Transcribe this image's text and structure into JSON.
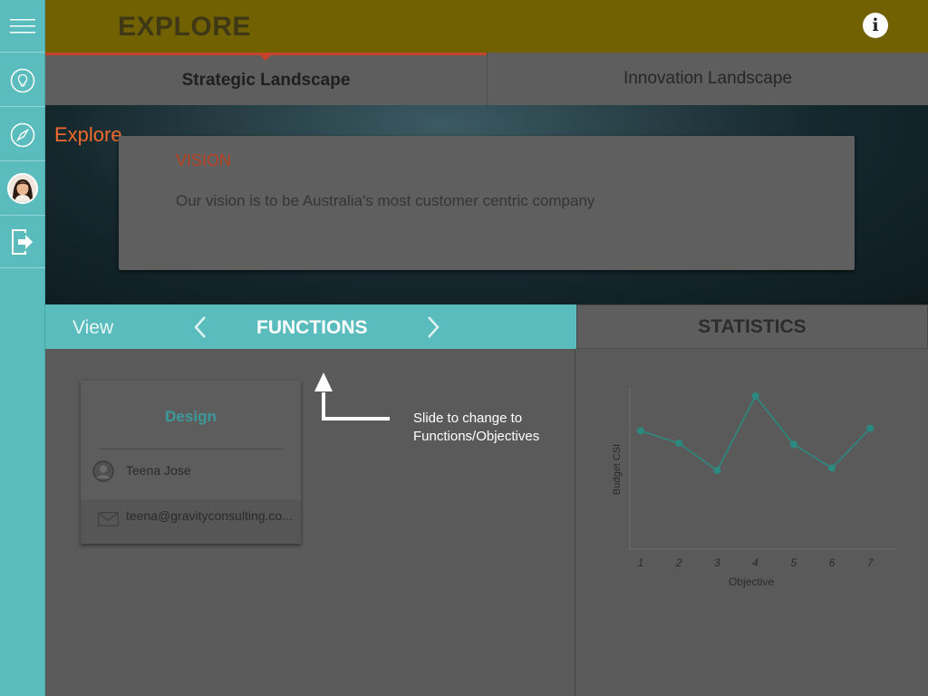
{
  "header": {
    "title": "EXPLORE"
  },
  "tabs": [
    {
      "label": "Strategic Landscape",
      "active": true
    },
    {
      "label": "Innovation Landscape",
      "active": false
    }
  ],
  "banner": {
    "section_label": "Explore",
    "vision_title": "VISION",
    "vision_text": "Our vision is to be Australia's most customer centric company"
  },
  "view_bar": {
    "view_label": "View",
    "current": "FUNCTIONS"
  },
  "statistics": {
    "title": "STATISTICS"
  },
  "function_card": {
    "title": "Design",
    "person_name": "Teena Jose",
    "email": "teena@gravityconsulting.co..."
  },
  "hint": {
    "line1": "Slide to change to",
    "line2": "Functions/Objectives"
  },
  "sidebar": {
    "icons": [
      "menu-icon",
      "lightbulb-icon",
      "compass-icon",
      "avatar",
      "logout-icon"
    ]
  },
  "colors": {
    "sidebar": "#5bbcbe",
    "header": "#726100",
    "accent_orange": "#ef6a2d",
    "vision_red": "#b8411f",
    "teal_line": "#2a8a80"
  },
  "chart_data": {
    "type": "line",
    "xlabel": "Objective",
    "ylabel": "Budget CSI",
    "x": [
      1,
      2,
      3,
      4,
      5,
      6,
      7
    ],
    "series": [
      {
        "values": [
          0.72,
          0.62,
          0.4,
          1.0,
          0.61,
          0.42,
          0.74
        ]
      }
    ],
    "grid": false
  }
}
